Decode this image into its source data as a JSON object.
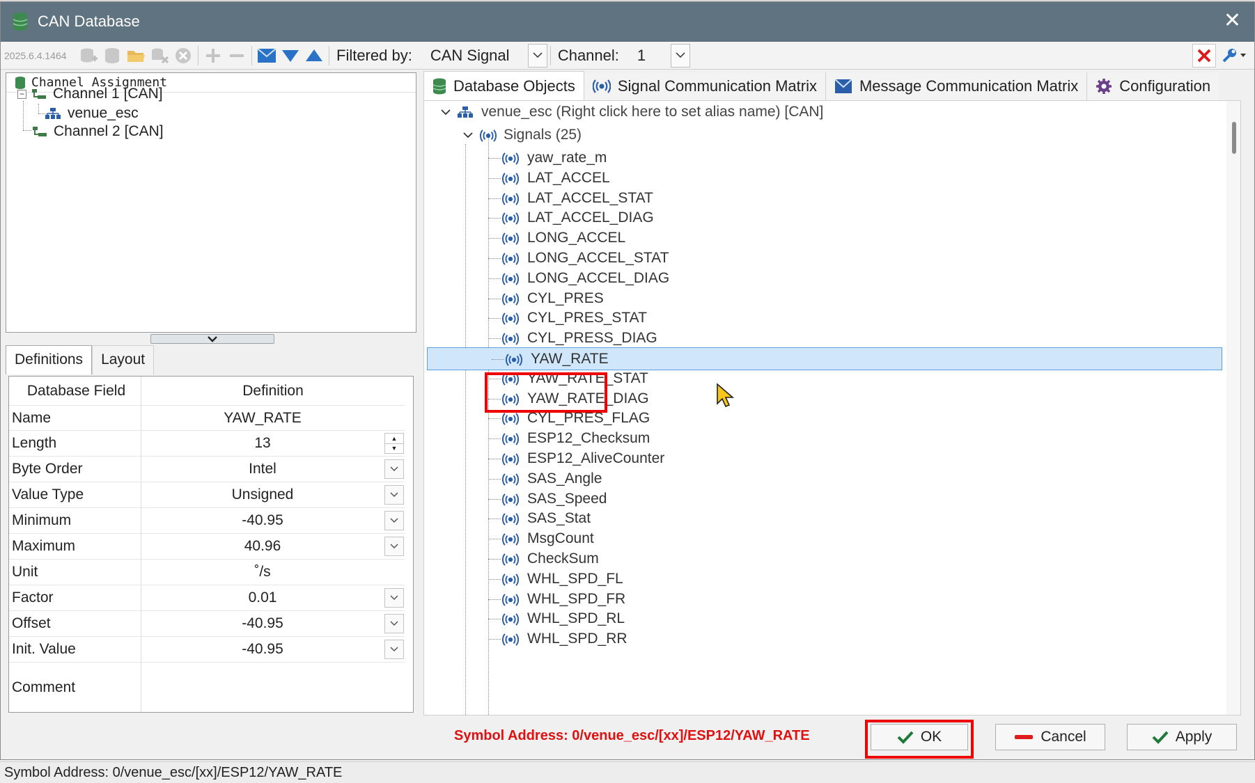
{
  "window": {
    "title": "CAN Database",
    "close_glyph": "✕"
  },
  "toolbar": {
    "version": "2025.6.4.1464",
    "filter_label": "Filtered by:",
    "filter_value": "CAN Signal",
    "channel_label": "Channel:",
    "channel_value": "1",
    "icons": [
      "add-database-icon",
      "database-icon",
      "open-folder-icon",
      "remove-database-icon",
      "close-circle-icon",
      "plus-icon",
      "minus-icon",
      "envelope-icon",
      "arrow-down-icon",
      "arrow-up-icon"
    ],
    "accent": "#2a72c5"
  },
  "left_tree": {
    "header": "Channel Assignment",
    "items": [
      {
        "label": "Channel 1 [CAN]",
        "expander": "−"
      },
      {
        "label": "venue_esc"
      },
      {
        "label": "Channel 2 [CAN]"
      }
    ]
  },
  "def_tabs": [
    "Definitions",
    "Layout"
  ],
  "definitions": {
    "headers": {
      "field": "Database Field",
      "definition": "Definition"
    },
    "rows": [
      {
        "field": "Name",
        "value": "YAW_RATE",
        "control": "none"
      },
      {
        "field": "Length",
        "value": "13",
        "control": "spin"
      },
      {
        "field": "Byte Order",
        "value": "Intel",
        "control": "drop"
      },
      {
        "field": "Value Type",
        "value": "Unsigned",
        "control": "drop"
      },
      {
        "field": "Minimum",
        "value": "-40.95",
        "control": "drop"
      },
      {
        "field": "Maximum",
        "value": "40.96",
        "control": "drop"
      },
      {
        "field": "Unit",
        "value": "˚/s",
        "control": "none"
      },
      {
        "field": "Factor",
        "value": "0.01",
        "control": "drop"
      },
      {
        "field": "Offset",
        "value": "-40.95",
        "control": "drop"
      },
      {
        "field": "Init. Value",
        "value": "-40.95",
        "control": "drop"
      },
      {
        "field": "Comment",
        "value": "",
        "control": "none"
      }
    ]
  },
  "right_tabs": [
    "Database Objects",
    "Signal Communication Matrix",
    "Message Communication Matrix",
    "Configuration"
  ],
  "right_tree": {
    "root": "venue_esc (Right click here to set alias name) [CAN]",
    "signals_group": "Signals (25)",
    "signals": [
      "yaw_rate_m",
      "LAT_ACCEL",
      "LAT_ACCEL_STAT",
      "LAT_ACCEL_DIAG",
      "LONG_ACCEL",
      "LONG_ACCEL_STAT",
      "LONG_ACCEL_DIAG",
      "CYL_PRES",
      "CYL_PRES_STAT",
      "CYL_PRESS_DIAG",
      "YAW_RATE",
      "YAW_RATE_STAT",
      "YAW_RATE_DIAG",
      "CYL_PRES_FLAG",
      "ESP12_Checksum",
      "ESP12_AliveCounter",
      "SAS_Angle",
      "SAS_Speed",
      "SAS_Stat",
      "MsgCount",
      "CheckSum",
      "WHL_SPD_FL",
      "WHL_SPD_FR",
      "WHL_SPD_RL",
      "WHL_SPD_RR"
    ],
    "selected": "YAW_RATE"
  },
  "bottom": {
    "symbol_address": "Symbol Address: 0/venue_esc/[xx]/ESP12/YAW_RATE",
    "ok": "OK",
    "cancel": "Cancel",
    "apply": "Apply"
  },
  "status_bar": "Symbol Address: 0/venue_esc/[xx]/ESP12/YAW_RATE",
  "colors": {
    "titlebar": "#5f7380",
    "selection": "#cfe6fb",
    "highlight_red": "#e00000",
    "icon_blue": "#2a5ea8",
    "check_green": "#1f7a3a"
  }
}
